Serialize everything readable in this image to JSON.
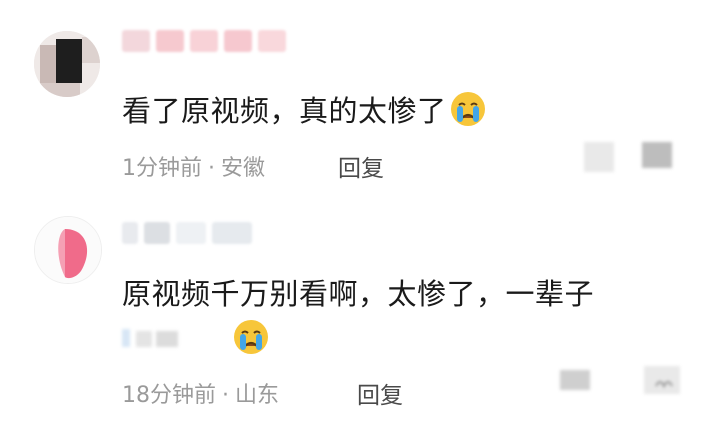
{
  "comments": [
    {
      "text": "看了原视频，真的太惨了",
      "emoji": "crying-face-emoji",
      "time": "1分钟前",
      "separator": "·",
      "location": "安徽",
      "reply_label": "回复"
    },
    {
      "text": "原视频千万别看啊，太惨了，一辈子",
      "emoji": "crying-face-emoji",
      "time": "18分钟前",
      "separator": "·",
      "location": "山东",
      "reply_label": "回复"
    }
  ],
  "colors": {
    "text": "#1a1a1a",
    "meta": "#9a9a9a",
    "reply": "#4a4a4a",
    "emoji_face": "#f7c63a",
    "emoji_tear": "#43a6e8"
  }
}
